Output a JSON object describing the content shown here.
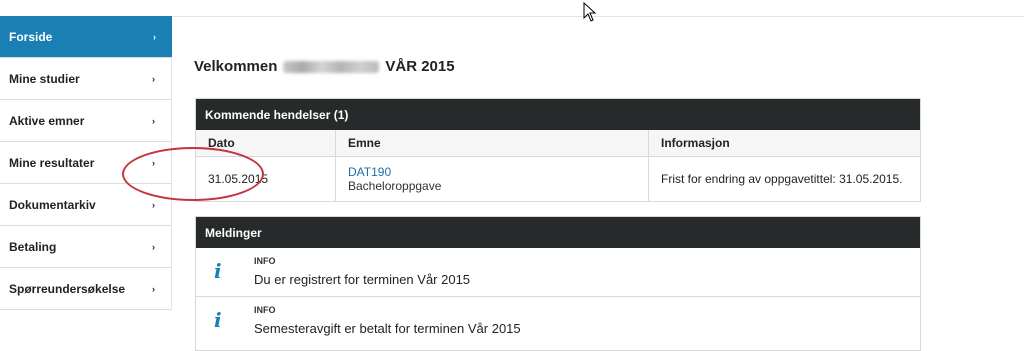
{
  "sidebar": {
    "items": [
      {
        "label": "Forside",
        "active": true
      },
      {
        "label": "Mine studier",
        "active": false
      },
      {
        "label": "Aktive emner",
        "active": false
      },
      {
        "label": "Mine resultater",
        "active": false
      },
      {
        "label": "Dokumentarkiv",
        "active": false
      },
      {
        "label": "Betaling",
        "active": false
      },
      {
        "label": "Spørreundersøkelse",
        "active": false
      }
    ],
    "chevron": "›"
  },
  "welcome": {
    "prefix": "Velkommen",
    "suffix": "VÅR 2015"
  },
  "events": {
    "title": "Kommende hendelser (1)",
    "columns": [
      "Dato",
      "Emne",
      "Informasjon"
    ],
    "rows": [
      {
        "date": "31.05.2015",
        "course_code": "DAT190",
        "course_name": "Bacheloroppgave",
        "info": "Frist for endring av oppgavetittel: 31.05.2015."
      }
    ]
  },
  "messages": {
    "title": "Meldinger",
    "items": [
      {
        "tag": "INFO",
        "text": "Du er registrert for terminen Vår 2015",
        "icon": "info-icon"
      },
      {
        "tag": "INFO",
        "text": "Semesteravgift er betalt for terminen Vår 2015",
        "icon": "info-icon"
      }
    ]
  },
  "colors": {
    "accent": "#1a7fb3",
    "panel_header": "#262a2b",
    "highlight_circle": "#c0363a"
  }
}
